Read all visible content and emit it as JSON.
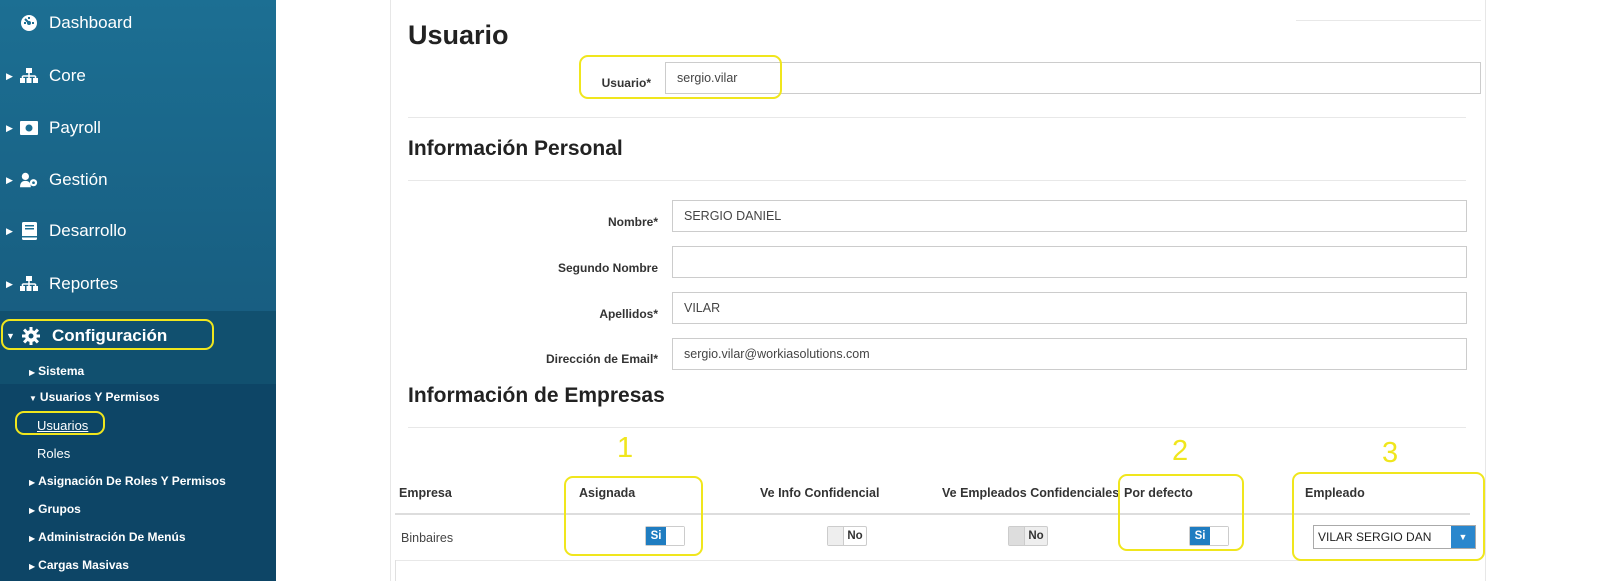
{
  "sidebar": {
    "items": [
      {
        "label": "Dashboard",
        "icon": "dashboard-icon"
      },
      {
        "label": "Core",
        "icon": "sitemap-icon"
      },
      {
        "label": "Payroll",
        "icon": "money-icon"
      },
      {
        "label": "Gestión",
        "icon": "user-cog-icon"
      },
      {
        "label": "Desarrollo",
        "icon": "book-icon"
      },
      {
        "label": "Reportes",
        "icon": "sitemap-icon"
      },
      {
        "label": "Configuración",
        "icon": "gear-icon"
      }
    ],
    "sub_items": {
      "sistema": "Sistema",
      "usuarios_permisos": "Usuarios Y Permisos",
      "usuarios": "Usuarios",
      "roles": "Roles",
      "asignacion": "Asignación De Roles Y Permisos",
      "grupos": "Grupos",
      "admin_menus": "Administración De Menús",
      "cargas": "Cargas Masivas"
    }
  },
  "form": {
    "title": "Usuario",
    "usuario_label": "Usuario*",
    "usuario_value": "sergio.vilar",
    "personal_title": "Información Personal",
    "nombre_label": "Nombre*",
    "nombre_value": "SERGIO DANIEL",
    "segundo_label": "Segundo Nombre",
    "segundo_value": "",
    "apellidos_label": "Apellidos*",
    "apellidos_value": "VILAR",
    "email_label": "Dirección de Email*",
    "email_value": "sergio.vilar@workiasolutions.com",
    "empresas_title": "Información de Empresas"
  },
  "table": {
    "headers": [
      "Empresa",
      "Asignada",
      "Ve Info Confidencial",
      "Ve Empleados Confidenciales",
      "Por defecto",
      "Empleado"
    ],
    "row": {
      "empresa": "Binbaires",
      "asignada": "Si",
      "ve_info": "No",
      "ve_empleados": "No",
      "por_defecto": "Si",
      "empleado": "VILAR SERGIO DAN"
    }
  },
  "annotations": [
    "1",
    "2",
    "3"
  ],
  "colors": {
    "highlight": "#f0e61d",
    "sidebar": "#1c6f93",
    "toggle_on": "#1f7dc1"
  }
}
